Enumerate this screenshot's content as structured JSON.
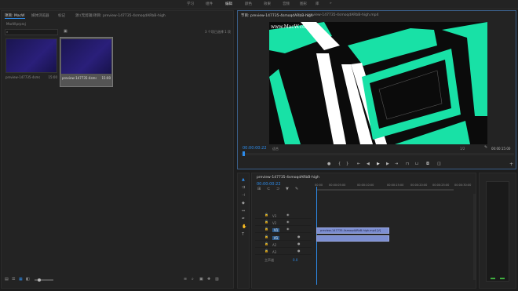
{
  "workspaces": [
    "学习",
    "组件",
    "编辑",
    "颜色",
    "效果",
    "音频",
    "图形",
    "库"
  ],
  "project": {
    "tabs": [
      "项目: MacW",
      "媒体浏览器",
      "标记",
      "源:(无剪辑)项目: preview-147735-4smoqdARbB-high"
    ],
    "folder": "MacW.prproj",
    "items_label": "3 个项已选择 1 项",
    "items": [
      {
        "name": "preview-147735-4smoqdAB...",
        "duration": "15:00"
      },
      {
        "name": "preview-147735-4smoqdAB...",
        "duration": "15:00"
      }
    ]
  },
  "program": {
    "tabs": [
      "节目: preview-147735-4smoqdARbB-high",
      "preview-147735-4smoqdARbB-high.mp4"
    ],
    "watermark": "www.MacW.com",
    "timecode_current": "00:00:00:22",
    "fit": "适合",
    "quality": "1/2",
    "timecode_duration": "00:00:15:00"
  },
  "timeline": {
    "tab": "preview-147735-4smoqdARbB-high",
    "timecode": "00:00:00:22",
    "ruler": [
      "00:00",
      "00:00:05:00",
      "00:00:10:00",
      "00:00:15:00",
      "00:00:20:00",
      "00:00:25:00",
      "00:00:30:00"
    ],
    "tracks_v": [
      "V3",
      "V2",
      "V1"
    ],
    "tracks_a": [
      "A1",
      "A2",
      "A3"
    ],
    "master": "主声道",
    "master_val": "0.0",
    "clip_label": "preview-147735-4smoqdARbB-high.mp4 [V]"
  },
  "colors": {
    "accent": "#2d8ceb",
    "teal": "#18e1a6",
    "clip": "#7d8fd2"
  }
}
